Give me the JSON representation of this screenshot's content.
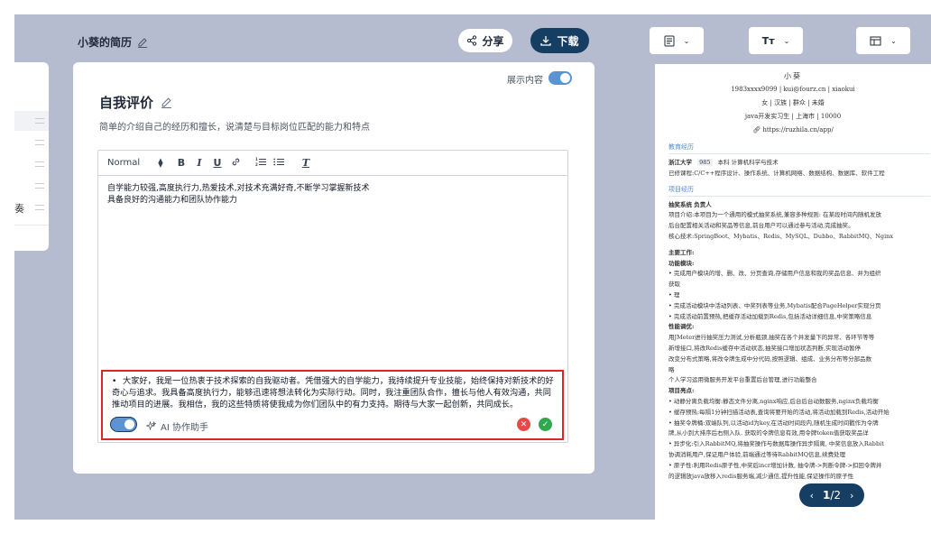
{
  "header": {
    "resume_name": "小葵的简历",
    "share_label": "分享",
    "download_label": "下载"
  },
  "left_fragment": {
    "char": "奏"
  },
  "card": {
    "show_label": "展示内容",
    "section_title": "自我评价",
    "section_desc": "简单的介绍自己的经历和擅长，说清楚与目标岗位匹配的能力和特点",
    "toolbar": {
      "format_select": "Normal",
      "bold": "B",
      "italic": "I",
      "underline": "U",
      "clear": "T"
    },
    "editor_lines": [
      "自学能力较强,高度执行力,热爱技术,对技术充满好奇,不断学习掌握新技术",
      "具备良好的沟通能力和团队协作能力"
    ],
    "ai_text": "大家好，我是一位热衷于技术探索的自我驱动者。凭借强大的自学能力，我持续提升专业技能，始终保持对新技术的好奇心与追求。我具备高度执行力，能够迅速将想法转化为实际行动。同时，我注重团队合作，擅长与他人有效沟通，共同推动项目的进展。我相信，我的这些特质将使我成为你们团队中的有力支持。期待与大家一起创新，共同成长。",
    "ai_label": "AI 协作助手"
  },
  "preview_toolbar": {
    "font_label": "Tт"
  },
  "resume": {
    "name": "小葵",
    "contact": "1983xxxx9099 | kui@fourz.cn | xiaokui",
    "info": "女 | 汉族 | 群众 | 未婚",
    "job": "java开发实习生 | 上海市 | 10000",
    "link": "https://ruzhila.cn/app/",
    "edu_title": "教育经历",
    "edu_line1_school": "浙江大学",
    "edu_line1_tag": "985",
    "edu_line1_rest": "本科  计算机科学与技术",
    "edu_line2": "已修课程:C/C++程序设计、操作系统、计算机网络、数据结构、数据库、软件工程",
    "proj_title": "项目经历",
    "proj_lines": [
      "抽奖系统  负责人",
      "项目介绍:本项目为一个通用的模式抽奖系统,兼容多种规则: 在某段时间内随机发放",
      "后台配置相关活动和奖品等信息,前台用户可以通过参与活动,完成抽奖。",
      "核心技术:SpringBoot、Mybatis、Redis、MySQL、Dubbo、RabbitMQ、Nginx",
      "",
      "主要工作:",
      "功能模块:",
      "• 完成用户模块的增、删、改、分页查询,存储用户信息和我的奖品信息、并为组织",
      "  获取",
      "• 理",
      "• 完成活动模块中活动列表、中奖列表等业务,Mybatis配合PageHelper实现分页",
      "• 完成活动前置预热,把缓存活动加载到Redis,包括活动详细信息,中奖策略信息",
      "性能调优:",
      "用JMeter进行抽奖压力测试,分析瓶颈,抽奖在各个并发量下的异常、各环节等等",
      "新增接口,将改Redis缓存中活动状态,抽奖接口增加状态判断,实现活动暂停",
      "改变分布式策略,将改令牌生成中分代码,按照逻辑、组成、业务分布等分部品数",
      "略",
      "个人学习运用微服务开发平台重置后台管理,进行功能整合",
      "项目亮点:",
      "• 动静分离负载均衡:静态文件分离,nginx响应,后台后台动数服务,nginx负载均衡",
      "• 缓存预热:每隔1分钟扫描活动表,查询将要开始的活动,将活动加载到Redis,活动开始",
      "• 抽奖令牌桶:双端队列,以活动id为key,在活动时间段内,随机生成时间戳作为令牌",
      "  牌,从小到大排序后右侧入队. 获取的令牌信息有效,用令牌token值获取奖品详",
      "• 异步化:引入RabbitMQ,将抽奖操作与数据库操作异步隔离, 中奖信息放入Rabbit",
      "  协调消耗用户,保证用户体验,前端通过等待RabbitMQ信息,续费处理",
      "• 原子性:利用Redis原子性,中奖后incr增加计数, 抽令牌->判断令牌->扣回令牌并",
      "  的逻辑放java放移入redis服务端,减少通信,提升性能,保证操作的原子性"
    ]
  },
  "pager": {
    "current": "1",
    "total": "2",
    "sep": "/"
  },
  "colors": {
    "accent": "#163e63",
    "toggle": "#5b93d3",
    "highlight_border": "#d62828",
    "section_blue": "#4b8bd8"
  }
}
